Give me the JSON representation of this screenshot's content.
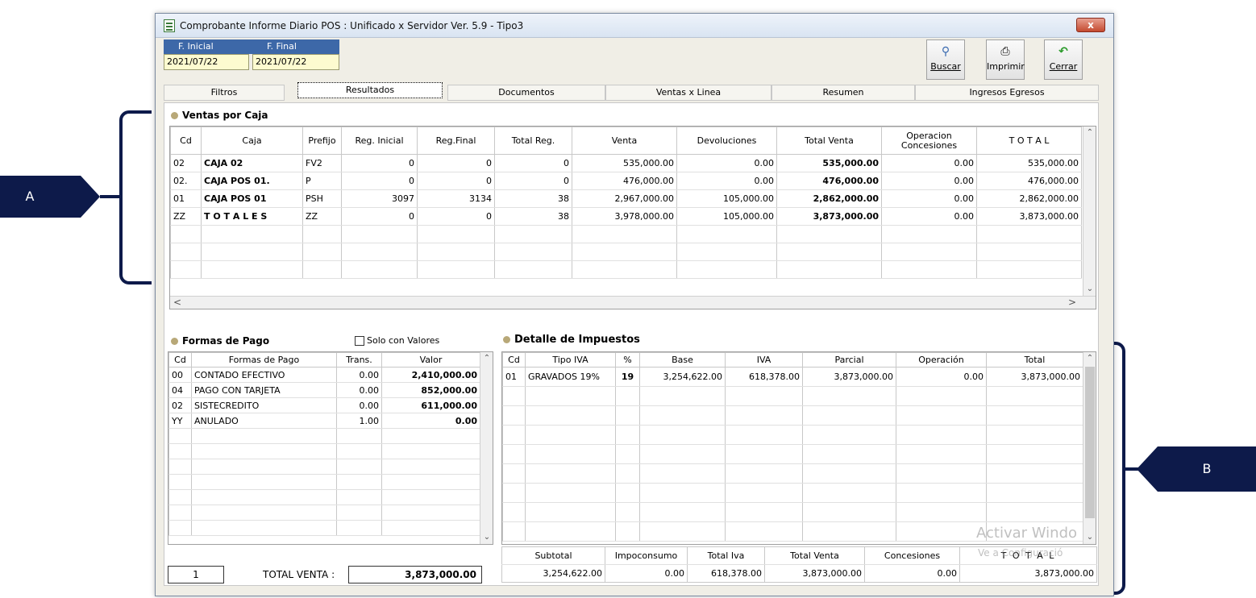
{
  "window": {
    "title": "Comprobante Informe Diario POS : Unificado x Servidor  Ver. 5.9 - Tipo3",
    "close": "x"
  },
  "dates": {
    "start_label": "F. Inicial",
    "end_label": "F. Final",
    "start_value": "2021/07/22",
    "end_value": "2021/07/22"
  },
  "toolbar": {
    "buscar": "Buscar",
    "imprimir": "Imprimir",
    "cerrar": "Cerrar"
  },
  "tabs": [
    "Filtros",
    "Resultados",
    "Documentos",
    "Ventas x Linea",
    "Resumen",
    "Ingresos Egresos"
  ],
  "ventas": {
    "title": "Ventas por Caja",
    "columns": [
      "Cd",
      "Caja",
      "Prefijo",
      "Reg. Inicial",
      "Reg.Final",
      "Total Reg.",
      "Venta",
      "Devoluciones",
      "Total Venta",
      "Operacion Concesiones",
      "T O T A L"
    ],
    "rows": [
      [
        "02",
        "CAJA 02",
        "FV2",
        "0",
        "0",
        "0",
        "535,000.00",
        "0.00",
        "535,000.00",
        "0.00",
        "535,000.00"
      ],
      [
        "02.",
        "CAJA POS 01.",
        "P",
        "0",
        "0",
        "0",
        "476,000.00",
        "0.00",
        "476,000.00",
        "0.00",
        "476,000.00"
      ],
      [
        "01",
        "CAJA POS 01",
        "PSH",
        "3097",
        "3134",
        "38",
        "2,967,000.00",
        "105,000.00",
        "2,862,000.00",
        "0.00",
        "2,862,000.00"
      ],
      [
        "ZZ",
        "T O T A L E S",
        "ZZ",
        "0",
        "0",
        "38",
        "3,978,000.00",
        "105,000.00",
        "3,873,000.00",
        "0.00",
        "3,873,000.00"
      ]
    ]
  },
  "pagos": {
    "title": "Formas de Pago",
    "solo_label": "Solo con Valores",
    "columns": [
      "Cd",
      "Formas de Pago",
      "Trans.",
      "Valor"
    ],
    "rows": [
      [
        "00",
        "CONTADO EFECTIVO",
        "0.00",
        "2,410,000.00"
      ],
      [
        "04",
        "PAGO CON TARJETA",
        "0.00",
        "852,000.00"
      ],
      [
        "02",
        "SISTECREDITO",
        "0.00",
        "611,000.00"
      ],
      [
        "YY",
        "ANULADO",
        "1.00",
        "0.00"
      ]
    ],
    "count": "1",
    "total_label": "TOTAL VENTA :",
    "total_value": "3,873,000.00"
  },
  "impuestos": {
    "title": "Detalle de Impuestos",
    "columns": [
      "Cd",
      "Tipo IVA",
      "%",
      "Base",
      "IVA",
      "Parcial",
      "Operación",
      "Total"
    ],
    "rows": [
      [
        "01",
        "GRAVADOS 19%",
        "19",
        "3,254,622.00",
        "618,378.00",
        "3,873,000.00",
        "0.00",
        "3,873,000.00"
      ]
    ],
    "summary_labels": [
      "Subtotal",
      "Impoconsumo",
      "Total Iva",
      "Total Venta",
      "Concesiones",
      "T O T A L"
    ],
    "summary_values": [
      "3,254,622.00",
      "0.00",
      "618,378.00",
      "3,873,000.00",
      "0.00",
      "3,873,000.00"
    ]
  },
  "annotations": {
    "a": "A",
    "b": "B"
  },
  "watermark": {
    "line1": "Activar Windo",
    "line2": "Ve a Configuració"
  }
}
